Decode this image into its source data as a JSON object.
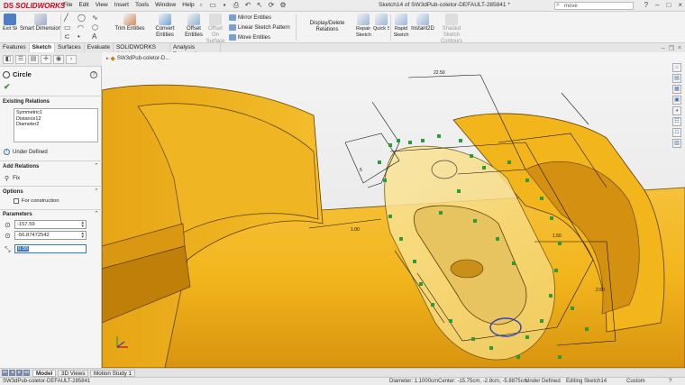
{
  "app": {
    "logo_text": "SOLIDWORKS",
    "window_title": "Sketch14 of SW3dPub-coletor-DEFAULT-285841 *",
    "search_text": "move",
    "menu": [
      "File",
      "Edit",
      "View",
      "Insert",
      "Tools",
      "Window",
      "Help"
    ],
    "qat_icons": [
      "new-icon",
      "open-icon",
      "save-icon",
      "print-icon",
      "undo-icon",
      "select-icon",
      "rebuild-icon",
      "options-icon"
    ]
  },
  "ribbon": {
    "exit_sketch": "Exit Sketch",
    "smart_dimension": "Smart Dimension",
    "trim_entities": "Trim Entities",
    "convert_entities": "Convert Entities",
    "offset_entities": "Offset Entities",
    "offset_on_surface": "Offset On Surface",
    "mirror_entities": "Mirror Entities",
    "linear_sketch_pattern": "Linear Sketch Pattern",
    "move_entities": "Move Entities",
    "display_delete_relations": "Display/Delete Relations",
    "repair_sketch": "Repair Sketch",
    "quick_snaps": "Quick Snaps",
    "rapid_sketch": "Rapid Sketch",
    "instant2d": "Instant2D",
    "shaded_sketch_contours": "Shaded Sketch Contours"
  },
  "tabs": [
    "Features",
    "Sketch",
    "Surfaces",
    "Evaluate",
    "SOLIDWORKS Add-Ins",
    "Analysis Preparation"
  ],
  "active_tab": "Sketch",
  "property_manager": {
    "title": "Circle",
    "existing_relations_title": "Existing Relations",
    "relations": [
      "Symmetric1",
      "Distance12",
      "Diameter2"
    ],
    "status": "Under Defined",
    "add_relations_title": "Add Relations",
    "add_relation_option": "Fix",
    "options_title": "Options",
    "for_construction": "For construction",
    "parameters_title": "Parameters",
    "param_x": "-157.59",
    "param_y": "-56.87472542",
    "param_radius": "0.55"
  },
  "viewport": {
    "tree_label": "SW3dPub-coletor-D..."
  },
  "bottom_tabs": [
    "Model",
    "3D Views",
    "Motion Study 1"
  ],
  "active_bottom_tab": "Model",
  "statusbar": {
    "doc": "SW3dPub-coletor-DEFAULT-285841",
    "diameter": "Diameter: 1.1000cm",
    "center": "Center: -15.75cm, -2.8cm, -5.8875cm",
    "defined": "Under Defined",
    "editing": "Editing Sketch14",
    "units": "Custom"
  },
  "colors": {
    "part_yellow": "#f2b51c",
    "part_dark": "#c8870c",
    "relation_green": "#2e9a3a",
    "selected_blue": "#2a3fbf"
  }
}
